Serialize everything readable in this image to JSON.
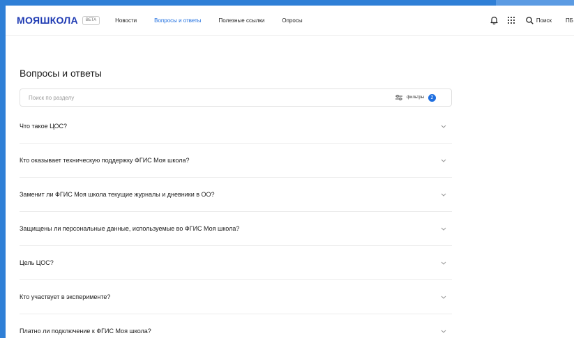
{
  "header": {
    "logo": "МОЯШКОЛА",
    "beta": "BETA",
    "nav": [
      {
        "label": "Новости",
        "active": false
      },
      {
        "label": "Вопросы и ответы",
        "active": true
      },
      {
        "label": "Полезные ссылки",
        "active": false
      },
      {
        "label": "Опросы",
        "active": false
      }
    ],
    "search_label": "Поиск",
    "avatar": "ПБ"
  },
  "page": {
    "title": "Вопросы и ответы",
    "search_placeholder": "Поиск по разделу",
    "filters_label": "фильтры",
    "filters_count": "2"
  },
  "faq": [
    "Что такое ЦОС?",
    "Кто оказывает техническую поддержку ФГИС Моя школа?",
    "Заменит ли ФГИС Моя школа текущие журналы и дневники в ОО?",
    "Защищены ли персональные данные, используемые во ФГИС Моя школа?",
    "Цель ЦОС?",
    "Кто участвует в эксперименте?",
    "Платно ли подключение к ФГИС Моя школа?"
  ],
  "colors": {
    "accent": "#1f6fe0",
    "logo": "#1f3bb3",
    "frame": "#2f7fd6"
  }
}
